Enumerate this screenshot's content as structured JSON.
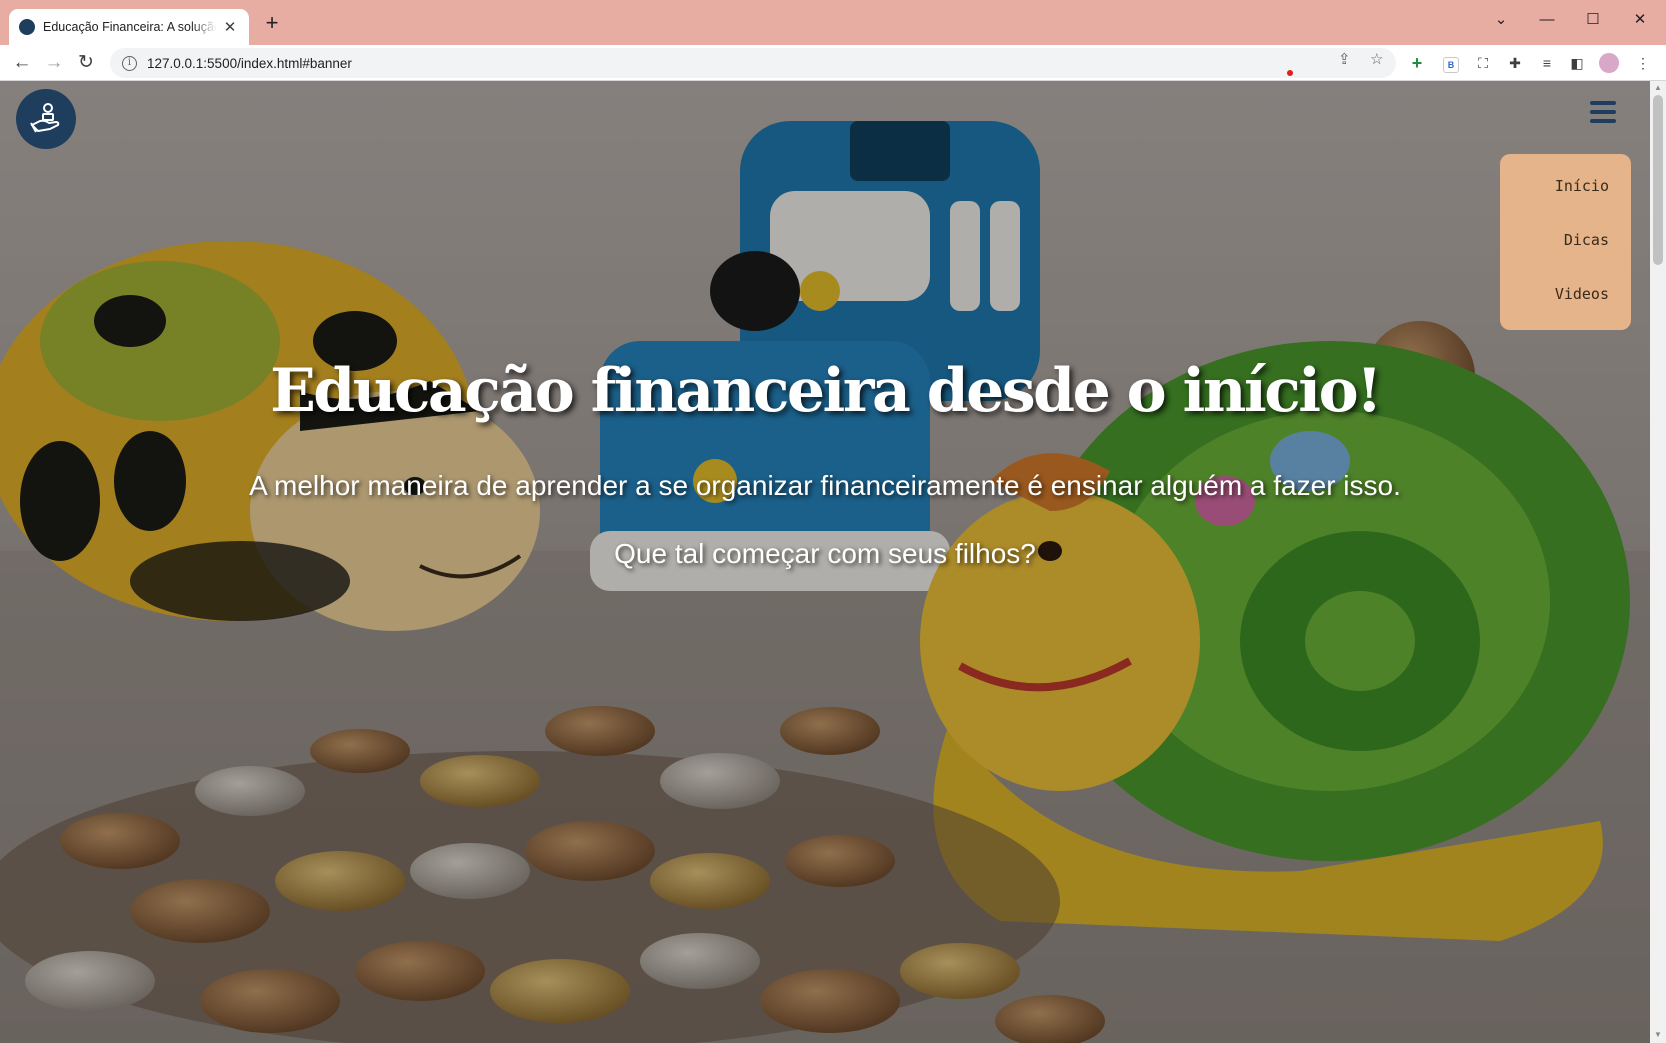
{
  "browser": {
    "tab_title": "Educação Financeira: A solução do futuro",
    "url": "127.0.0.1:5500/index.html#banner",
    "new_tab_glyph": "+",
    "tab_close_glyph": "✕"
  },
  "page": {
    "menu": [
      {
        "label": "Início"
      },
      {
        "label": "Dicas"
      },
      {
        "label": "Videos"
      }
    ],
    "hero": {
      "title": "Educação financeira desde o início!",
      "subtitle": "A melhor maneira de aprender a se organizar financeiramente é ensinar alguém a fazer isso.",
      "question": "Que tal começar com seus filhos?"
    }
  },
  "colors": {
    "chrome_frame": "#e8ada2",
    "logo_navy": "#1f3d5c",
    "menu_bg": "#e5b48a"
  },
  "icons": [
    "back-arrow-icon",
    "forward-arrow-icon",
    "reload-icon",
    "info-icon",
    "share-icon",
    "star-icon",
    "extensions-puzzle-icon",
    "hand-coin-logo-icon",
    "hamburger-menu-icon"
  ]
}
